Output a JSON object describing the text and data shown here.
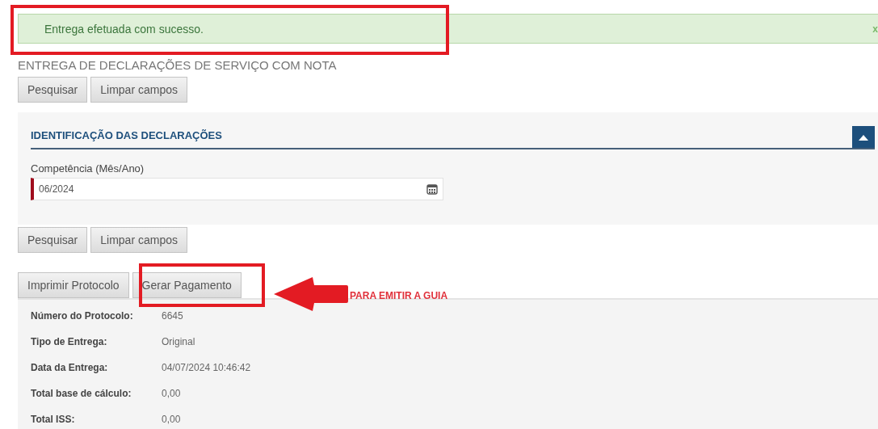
{
  "alert": {
    "message": "Entrega efetuada com sucesso.",
    "close": "x"
  },
  "page_title": "ENTREGA DE DECLARAÇÕES DE SERVIÇO COM NOTA",
  "top_buttons": [
    "Pesquisar",
    "Limpar campos"
  ],
  "panel": {
    "title": "IDENTIFICAÇÃO DAS DECLARAÇÕES",
    "expanded": true,
    "field": {
      "label": "Competência (Mês/Ano)",
      "value": "06/2024",
      "required": true
    }
  },
  "bottom_buttons": [
    "Pesquisar",
    "Limpar campos"
  ],
  "tabs": [
    {
      "label": "Imprimir Protocolo",
      "selected": false
    },
    {
      "label": "Gerar Pagamento",
      "selected": false
    }
  ],
  "details": [
    {
      "label": "Número do Protocolo:",
      "value": "6645"
    },
    {
      "label": "Tipo de Entrega:",
      "value": "Original"
    },
    {
      "label": "Data da Entrega:",
      "value": "04/07/2024 10:46:42"
    },
    {
      "label": "Total base de cálculo:",
      "value": "0,00"
    },
    {
      "label": "Total ISS:",
      "value": "0,00"
    }
  ],
  "annotation": {
    "label": "PARA EMITIR A GUIA"
  }
}
